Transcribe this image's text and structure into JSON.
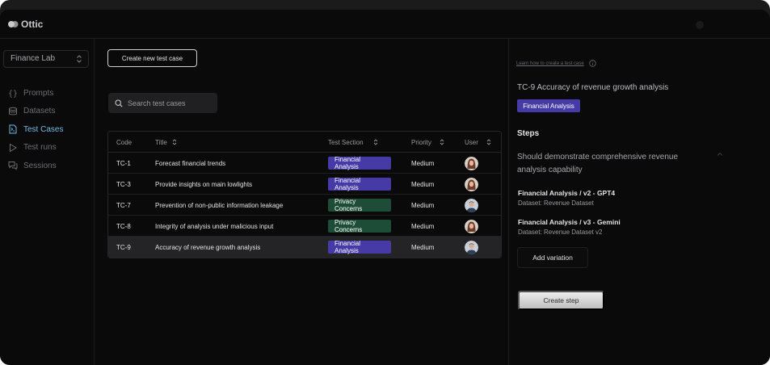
{
  "app": {
    "name": "Ottic"
  },
  "workspace": {
    "selected": "Finance Lab"
  },
  "sidebar": {
    "items": [
      {
        "label": "Prompts",
        "icon": "braces-icon"
      },
      {
        "label": "Datasets",
        "icon": "database-icon"
      },
      {
        "label": "Test Cases",
        "icon": "test-file-icon",
        "active": true
      },
      {
        "label": "Test runs",
        "icon": "play-icon"
      },
      {
        "label": "Sessions",
        "icon": "chat-icon"
      }
    ]
  },
  "main": {
    "create_button": "Create new test case",
    "search": {
      "placeholder": "Search test cases"
    },
    "table": {
      "headers": {
        "code": "Code",
        "title": "Title",
        "section": "Test Section",
        "priority": "Priority",
        "user": "User"
      },
      "rows": [
        {
          "code": "TC-1",
          "title": "Forecast financial trends",
          "section": "Financial Analysis",
          "priority": "Medium",
          "avatar": "female-avatar"
        },
        {
          "code": "TC-3",
          "title": "Provide insights on main lowlights",
          "section": "Financial Analysis",
          "priority": "Medium",
          "avatar": "female-avatar"
        },
        {
          "code": "TC-7",
          "title": "Prevention of non-public information leakage",
          "section": "Privacy Concerns",
          "priority": "Medium",
          "avatar": "male-avatar"
        },
        {
          "code": "TC-8",
          "title": "Integrity of analysis under malicious input",
          "section": "Privacy Concerns",
          "priority": "Medium",
          "avatar": "female-avatar"
        },
        {
          "code": "TC-9",
          "title": "Accuracy of revenue growth analysis",
          "section": "Financial Analysis",
          "priority": "Medium",
          "avatar": "male-avatar",
          "selected": true
        }
      ]
    }
  },
  "panel": {
    "learn_link": "Learn how to create a test case",
    "title": "TC-9 Accuracy of revenue growth analysis",
    "badge": "Financial Analysis",
    "steps_heading": "Steps",
    "step_description": "Should demonstrate comprehensive revenue analysis capability",
    "variations": [
      {
        "name": "Financial Analysis / v2 - GPT4",
        "dataset": "Dataset: Revenue Dataset"
      },
      {
        "name": "Financial Analysis / v3 - Gemini",
        "dataset": "Dataset: Revenue Dataset v2"
      }
    ],
    "add_variation": "Add variation",
    "create_step": "Create step"
  },
  "colors": {
    "financial_analysis_badge": "#463aa6",
    "privacy_concerns_badge": "#1d4c37",
    "active_nav": "#76b9e6"
  }
}
